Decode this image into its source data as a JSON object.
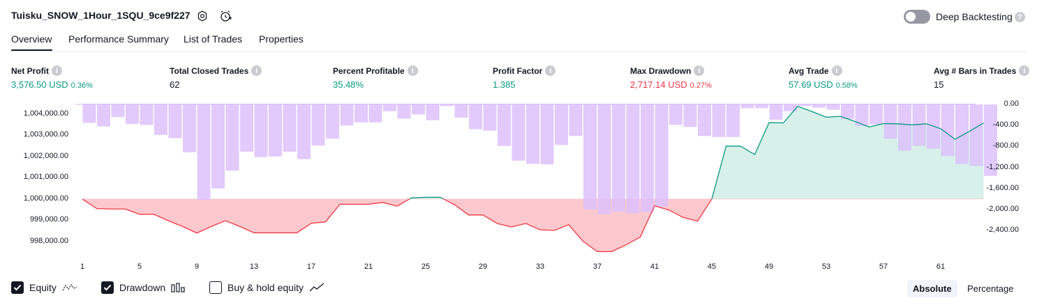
{
  "strategy_title": "Tuisku_SNOW_1Hour_1SQU_9ce9f227",
  "header": {
    "deep_backtesting_label": "Deep Backtesting",
    "deep_backtesting_enabled": false
  },
  "tabs": [
    {
      "label": "Overview",
      "active": true
    },
    {
      "label": "Performance Summary",
      "active": false
    },
    {
      "label": "List of Trades",
      "active": false
    },
    {
      "label": "Properties",
      "active": false
    }
  ],
  "metrics": [
    {
      "label": "Net Profit",
      "value": "3,576.50 USD",
      "pct": "0.36%",
      "color": "green"
    },
    {
      "label": "Total Closed Trades",
      "value": "62",
      "pct": "",
      "color": "neutral"
    },
    {
      "label": "Percent Profitable",
      "value": "35.48%",
      "pct": "",
      "color": "green"
    },
    {
      "label": "Profit Factor",
      "value": "1.385",
      "pct": "",
      "color": "green"
    },
    {
      "label": "Max Drawdown",
      "value": "2,717.14 USD",
      "pct": "0.27%",
      "color": "red"
    },
    {
      "label": "Avg Trade",
      "value": "57.69 USD",
      "pct": "0.58%",
      "color": "green"
    },
    {
      "label": "Avg # Bars in Trades",
      "value": "15",
      "pct": "",
      "color": "neutral"
    }
  ],
  "colors": {
    "profit": "#089981",
    "loss": "#f23645",
    "drawdown_bar": "#ddc1fb",
    "equity_fill_up": "#d7f0ea",
    "equity_fill_down": "#fbc9cd"
  },
  "chart_data": {
    "type": "line",
    "x_label_ticks": [
      "1",
      "5",
      "9",
      "13",
      "17",
      "21",
      "25",
      "29",
      "33",
      "37",
      "41",
      "45",
      "49",
      "53",
      "57",
      "61"
    ],
    "left_axis_ticks": [
      "1,004,000.00",
      "1,003,000.00",
      "1,002,000.00",
      "1,001,000.00",
      "1,000,000.00",
      "999,000.00",
      "998,000.00"
    ],
    "right_axis_ticks": [
      "0.00",
      "-400.00",
      "-800.00",
      "-1,200.00",
      "-1,600.00",
      "-2,000.00",
      "-2,400.00"
    ],
    "left_ylim": [
      997600,
      1004450
    ],
    "right_ylim": [
      -2770,
      0
    ],
    "baseline_equity": 1000000,
    "series": [
      {
        "kind": "equity",
        "x": [
          1,
          2,
          3,
          4,
          5,
          6,
          7,
          8,
          9,
          10,
          11,
          12,
          13,
          14,
          15,
          16,
          17,
          18,
          19,
          20,
          21,
          22,
          23,
          24,
          25,
          26,
          27,
          28,
          29,
          30,
          31,
          32,
          33,
          34,
          35,
          36,
          37,
          38,
          39,
          40,
          41,
          42,
          43,
          44,
          45,
          46,
          47,
          48,
          49,
          50,
          51,
          52,
          53,
          54,
          55,
          56,
          57,
          58,
          59,
          60,
          61,
          62,
          63,
          64
        ],
        "values": [
          1000000,
          999550,
          999530,
          999530,
          999280,
          999280,
          998980,
          998710,
          998400,
          998700,
          998980,
          998710,
          998410,
          998410,
          998410,
          998410,
          998860,
          998920,
          999750,
          999750,
          999750,
          999840,
          999660,
          1000050,
          1000080,
          1000080,
          999740,
          999250,
          999250,
          998850,
          998680,
          998850,
          998550,
          998520,
          998790,
          998010,
          997520,
          997520,
          997840,
          998210,
          999680,
          999480,
          999130,
          998960,
          1000000,
          1002490,
          1002490,
          1002090,
          1003590,
          1003580,
          1004360,
          1004120,
          1003850,
          1003890,
          1003650,
          1003390,
          1003550,
          1003540,
          1003490,
          1003540,
          1003310,
          1002810,
          1003180,
          1003580
        ]
      },
      {
        "kind": "drawdown",
        "x": [
          1,
          2,
          3,
          4,
          5,
          6,
          7,
          8,
          9,
          10,
          11,
          12,
          13,
          14,
          15,
          16,
          17,
          18,
          19,
          20,
          21,
          22,
          23,
          24,
          25,
          26,
          27,
          28,
          29,
          30,
          31,
          32,
          33,
          34,
          35,
          36,
          37,
          38,
          39,
          40,
          41,
          42,
          43,
          44,
          45,
          46,
          47,
          48,
          49,
          50,
          51,
          52,
          53,
          54,
          55,
          56,
          57,
          58,
          59,
          60,
          61,
          62,
          63,
          64
        ],
        "values": [
          -350,
          -420,
          -240,
          -370,
          -390,
          -580,
          -640,
          -910,
          -1820,
          -1600,
          -1260,
          -900,
          -1000,
          -990,
          -900,
          -1040,
          -780,
          -650,
          -400,
          -340,
          -340,
          -130,
          -270,
          -190,
          -300,
          -30,
          -250,
          -470,
          -500,
          -790,
          -1070,
          -1130,
          -1140,
          -770,
          -600,
          -2000,
          -2090,
          -2040,
          -2070,
          -2050,
          -1940,
          -390,
          -430,
          -600,
          -620,
          -620,
          -70,
          -70,
          -290,
          -130,
          -30,
          -60,
          -100,
          -280,
          -410,
          -380,
          -650,
          -880,
          -790,
          -840,
          -980,
          -1130,
          -1170,
          -1360
        ]
      }
    ]
  },
  "legend": [
    {
      "label": "Equity",
      "checked": true,
      "icon": "equity-line-icon"
    },
    {
      "label": "Drawdown",
      "checked": true,
      "icon": "drawdown-bars-icon"
    },
    {
      "label": "Buy & hold equity",
      "checked": false,
      "icon": "buy-hold-line-icon"
    }
  ],
  "scale_modes": [
    {
      "label": "Absolute",
      "active": true
    },
    {
      "label": "Percentage",
      "active": false
    }
  ]
}
